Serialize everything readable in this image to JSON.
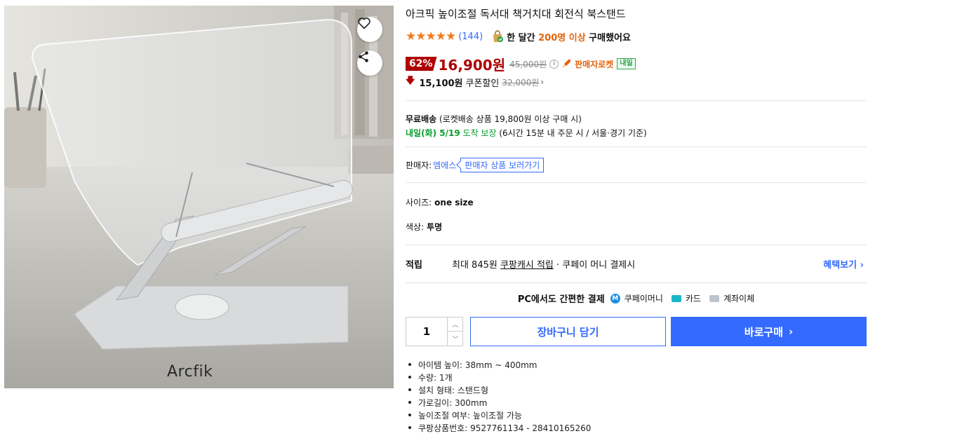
{
  "product": {
    "title": "아크픽 높이조절 독서대 책거치대 회전식 북스탠드",
    "image_brand": "Arcfik",
    "icons": {
      "wishlist": "heart-icon",
      "share": "share-icon"
    }
  },
  "rating": {
    "stars": "★★★★★",
    "review_count": "(144)",
    "sold_prefix": "한 달간 ",
    "sold_highlight": "200명 이상",
    "sold_suffix": " 구매했어요"
  },
  "price": {
    "discount": "62%",
    "sale": "16,900원",
    "original": "45,000원",
    "info_icon": "i",
    "rocket_label": "판매자로켓",
    "tomorrow_tag": "내일",
    "coupon_price": "15,100원",
    "coupon_label": "쿠폰할인",
    "coupon_original": "32,000원"
  },
  "shipping": {
    "free_label": "무료배송",
    "free_condition": "(로켓배송 상품 19,800원 이상 구매 시)",
    "arrival_date": "내일(화) 5/19",
    "arrival_label": "도착 보장",
    "arrival_condition": "(6시간 15분 내 주문 시 / 서울·경기 기준)"
  },
  "seller": {
    "label": "판매자:",
    "name": "엠에스",
    "button": "판매자 상품 보러가기"
  },
  "options": {
    "size_label": "사이즈:",
    "size_value": "one size",
    "color_label": "색상:",
    "color_value": "투명"
  },
  "reward": {
    "label": "적립",
    "prefix": "최대 845원 ",
    "link": "쿠팡캐시 적립",
    "suffix": " · 쿠페이 머니 결제시",
    "benefit_link": "혜택보기 ›"
  },
  "payment": {
    "title": "PC에서도 간편한 결제",
    "methods": [
      "쿠페이머니",
      "카드",
      "계좌이체"
    ]
  },
  "actions": {
    "quantity": "1",
    "cart": "장바구니 담기",
    "buy": "바로구매"
  },
  "specs": [
    "아이템 높이: 38mm ~ 400mm",
    "수량: 1개",
    "설치 형태: 스탠드형",
    "가로길이: 300mm",
    "높이조절 여부: 높이조절 가능",
    "쿠팡상품번호: 9527761134 - 28410165260"
  ],
  "colors": {
    "accent_blue": "#346aff",
    "price_red": "#ae0000",
    "highlight_orange": "#e3630c",
    "delivery_green": "#0a9b2f"
  }
}
